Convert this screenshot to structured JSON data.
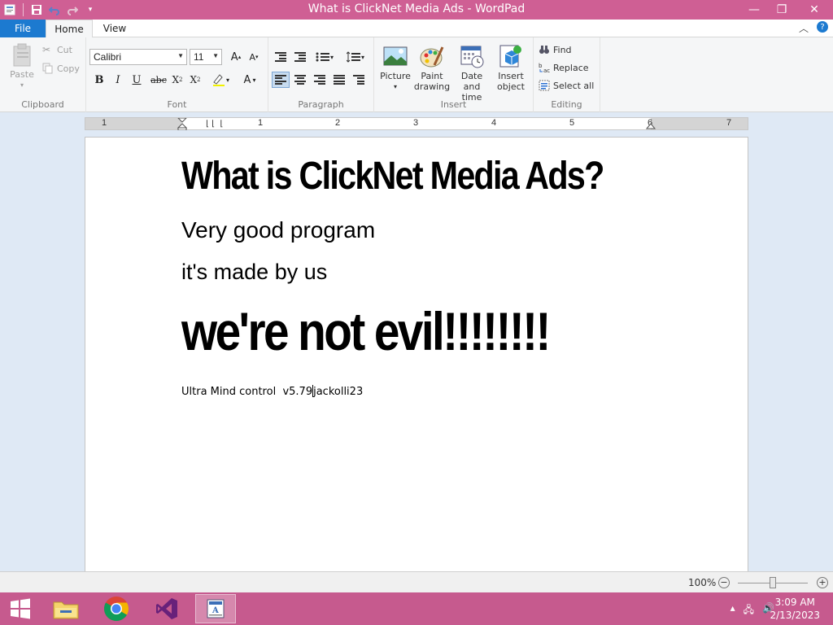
{
  "window": {
    "title": "What is ClickNet Media Ads - WordPad",
    "minimize_glyph": "—",
    "restore_glyph": "❐",
    "close_glyph": "✕"
  },
  "tabs": {
    "file": "File",
    "home": "Home",
    "view": "View"
  },
  "ribbon": {
    "clipboard": {
      "label": "Clipboard",
      "paste": "Paste",
      "cut": "Cut",
      "copy": "Copy"
    },
    "font": {
      "label": "Font",
      "family": "Calibri",
      "size": "11"
    },
    "paragraph": {
      "label": "Paragraph"
    },
    "insert": {
      "label": "Insert",
      "picture": "Picture",
      "paint_drawing": "Paint drawing",
      "date_time": "Date and time",
      "insert_object": "Insert object"
    },
    "editing": {
      "label": "Editing",
      "find": "Find",
      "replace": "Replace",
      "select_all": "Select all"
    }
  },
  "ruler": {
    "numbers": [
      "1",
      "1",
      "2",
      "3",
      "4",
      "5",
      "6",
      "7"
    ]
  },
  "document": {
    "heading": "What is ClickNet Media Ads?",
    "line1": "Very good program",
    "line2": "it's made by us",
    "big": "we're not evil!!!!!!!!",
    "small_before_caret": "Ultra Mind control  v5.79",
    "small_after_caret": "jackolli23"
  },
  "status": {
    "zoom": "100%"
  },
  "taskbar": {
    "time": "3:09 AM",
    "date": "2/13/2023",
    "apps": [
      "start",
      "file-explorer",
      "chrome",
      "visual-studio",
      "wordpad"
    ]
  },
  "colors": {
    "titlebar": "#cf5f94",
    "taskbar": "#c65a8e",
    "file_tab": "#1c7ad0"
  }
}
